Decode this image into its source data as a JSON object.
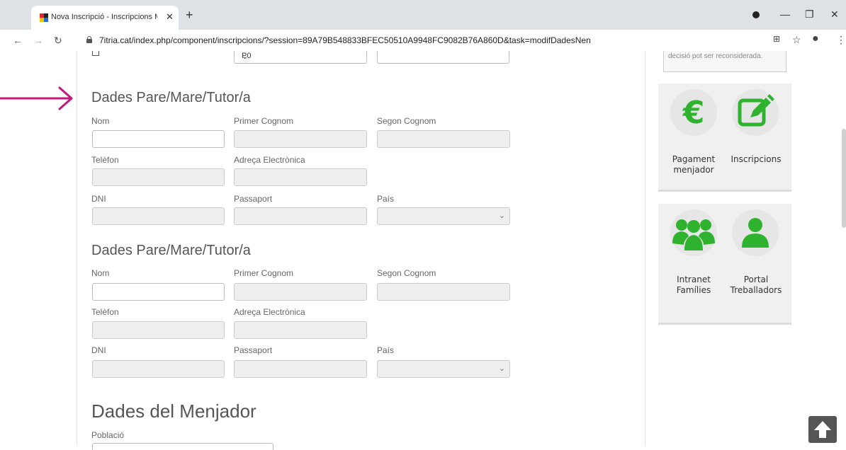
{
  "browser": {
    "tab_title": "Nova Inscripció - Inscripcions Me",
    "url": "7itria.cat/index.php/component/inscripcions/?session=89A79B548833BFEC50510A9948FC9082B76A860D&task=modifDadesNen"
  },
  "top_row": {
    "select_value": "P0"
  },
  "sections": [
    {
      "title": "Dades Pare/Mare/Tutor/a",
      "labels": {
        "nom": "Nom",
        "primer_cognom": "Primer Cognom",
        "segon_cognom": "Segon Cognom",
        "telefon": "Telèfon",
        "adreca": "Adreça Electrònica",
        "dni": "DNI",
        "passaport": "Passaport",
        "pais": "País"
      }
    },
    {
      "title": "Dades Pare/Mare/Tutor/a",
      "labels": {
        "nom": "Nom",
        "primer_cognom": "Primer Cognom",
        "segon_cognom": "Segon Cognom",
        "telefon": "Telèfon",
        "adreca": "Adreça Electrònica",
        "dni": "DNI",
        "passaport": "Passaport",
        "pais": "País"
      }
    }
  ],
  "menjador": {
    "title": "Dades del Menjador",
    "poblacio_label": "Població"
  },
  "sidebar": {
    "notice_text": "decisió pot ser reconsiderada.",
    "tiles": [
      {
        "label_1": "Pagament",
        "label_2": "menjador",
        "icon": "euro-icon",
        "color": "#2fb32f"
      },
      {
        "label_1": "Inscripcions",
        "label_2": "",
        "icon": "edit-icon",
        "color": "#2fb32f"
      },
      {
        "label_1": "Intranet",
        "label_2": "Famílies",
        "icon": "group-icon",
        "color": "#2fb32f"
      },
      {
        "label_1": "Portal",
        "label_2": "Treballadors",
        "icon": "user-icon",
        "color": "#2fb32f"
      }
    ]
  },
  "colors": {
    "accent_green": "#2fb32f",
    "arrow": "#c2187a"
  }
}
